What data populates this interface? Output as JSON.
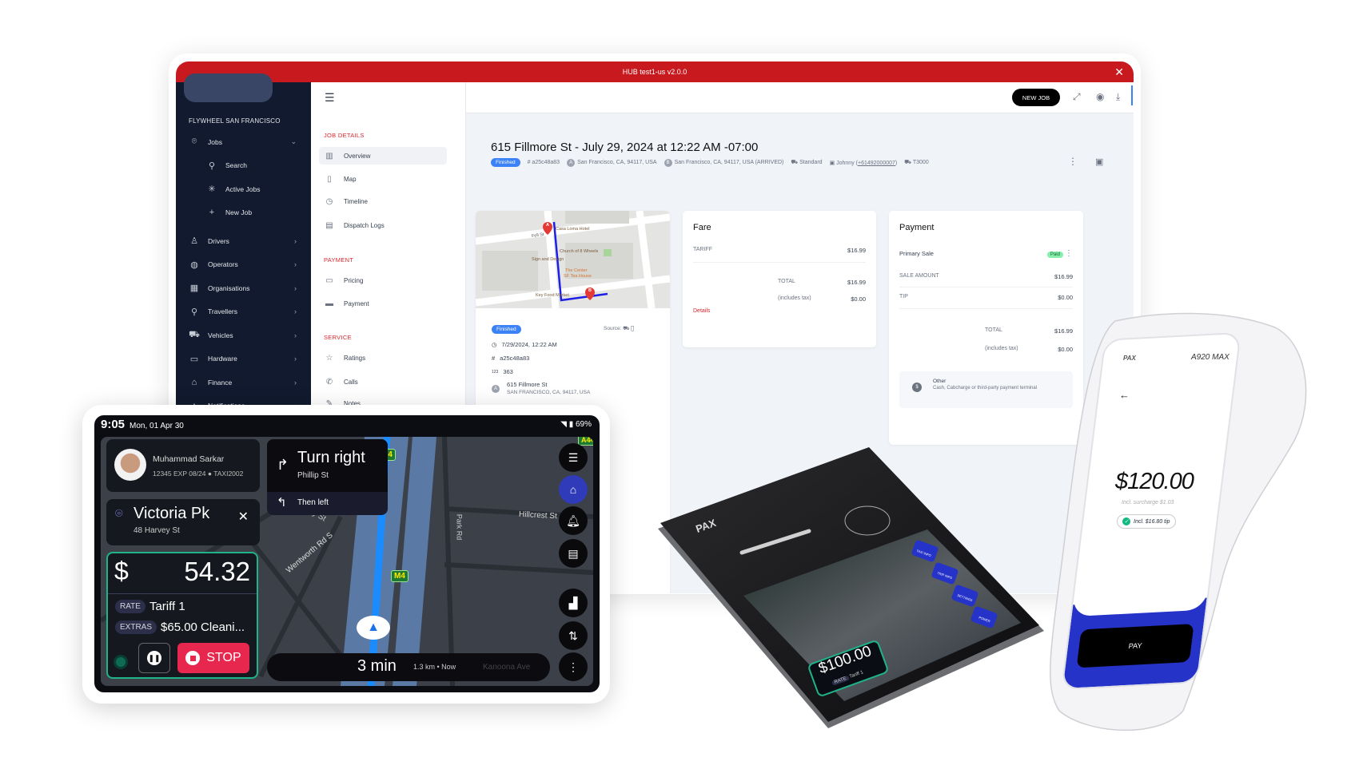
{
  "hub": {
    "window_title": "HUB test1-us v2.0.0",
    "org_name": "FLYWHEEL SAN FRANCISCO",
    "sidebar": [
      {
        "label": "Jobs",
        "icon": "map-pin-icon",
        "expanded": true
      },
      {
        "label": "Search",
        "icon": "search-icon",
        "sub": true
      },
      {
        "label": "Active Jobs",
        "icon": "loader-icon",
        "sub": true
      },
      {
        "label": "New Job",
        "icon": "plus-icon",
        "sub": true
      },
      {
        "label": "Drivers",
        "icon": "user-icon"
      },
      {
        "label": "Operators",
        "icon": "operators-icon"
      },
      {
        "label": "Organisations",
        "icon": "building-icon"
      },
      {
        "label": "Travellers",
        "icon": "traveller-icon"
      },
      {
        "label": "Vehicles",
        "icon": "car-icon"
      },
      {
        "label": "Hardware",
        "icon": "devices-icon"
      },
      {
        "label": "Finance",
        "icon": "bank-icon"
      },
      {
        "label": "Notifications",
        "icon": "bell-icon"
      }
    ],
    "secondary_nav": {
      "job_details": "JOB DETAILS",
      "overview": "Overview",
      "map": "Map",
      "timeline": "Timeline",
      "dispatch_logs": "Dispatch Logs",
      "payment_head": "PAYMENT",
      "pricing": "Pricing",
      "payment": "Payment",
      "service_head": "SERVICE",
      "ratings": "Ratings",
      "calls": "Calls",
      "notes": "Notes"
    },
    "header": {
      "new_job": "NEW JOB"
    },
    "job": {
      "title": "615 Fillmore St - July 29, 2024 at 12:22 AM -07:00",
      "status": "Finished",
      "id": "a25c48a83",
      "pickup": "San Francisco, CA, 94117, USA",
      "dropoff": "San Francisco, CA, 94117, USA (ARRIVED)",
      "service": "Standard",
      "driver": "Johnny (",
      "driver_phone": "+61492000007",
      "driver_close": ")",
      "vehicle": "T3000"
    },
    "map_labels": {
      "hotel": "Casa Loma Hotel",
      "street": "Fell St",
      "church": "Church of 8 Wheels",
      "sign": "Sign and Design",
      "center": "The Center",
      "tea": "SF Tea House",
      "market": "Key Food Market",
      "pin_a": "A",
      "pin_b": "B"
    },
    "details": {
      "status": "Finished",
      "source_label": "Source:",
      "datetime": "7/29/2024, 12:22 AM",
      "id": "a25c48a83",
      "number": "363",
      "address_line1": "615 Fillmore St",
      "address_line2": "SAN FRANCISCO, CA, 94117, USA"
    },
    "fare": {
      "title": "Fare",
      "tariff_label": "TARIFF",
      "tariff": "$16.99",
      "total_label": "TOTAL",
      "total": "$16.99",
      "tax_label": "(includes tax)",
      "tax": "$0.00",
      "details_link": "Details"
    },
    "payment": {
      "title": "Payment",
      "primary_sale": "Primary Sale",
      "status": "Paid",
      "sale_amount_label": "SALE AMOUNT",
      "sale_amount": "$16.99",
      "tip_label": "TIP",
      "tip": "$0.00",
      "total_label": "TOTAL",
      "total": "$16.99",
      "tax_label": "(includes tax)",
      "tax": "$0.00",
      "method_title": "Other",
      "method_desc": "Cash, Cabcharge or third-party payment terminal"
    }
  },
  "driver_tablet": {
    "time": "9:05",
    "date": "Mon, 01 Apr 30",
    "battery": "69%",
    "driver_name": "Muhammad Sarkar",
    "driver_info": "12345 EXP 08/24 ● TAXI2002",
    "nav_primary": "Turn right",
    "nav_street": "Phillip St",
    "nav_next": "Then left",
    "destination": "Victoria Pk",
    "destination_address": "48 Harvey St",
    "currency": "$",
    "fare": "54.32",
    "rate_label": "RATE",
    "rate": "Tariff 1",
    "extras_label": "EXTRAS",
    "extras": "$65.00 Cleani...",
    "stop": "STOP",
    "eta": "3 min",
    "eta_detail": "1.3 km • Now",
    "map_streets": [
      "Hillcrest St",
      "Park Rd",
      "Wentworth Rd S",
      "Pomeroy St",
      "Kanoona Ave"
    ],
    "road_shield": "M4",
    "road_shield_2": "A44"
  },
  "pax_terminal": {
    "brand": "PAX",
    "amount": "$100.00",
    "rate_label": "RATE",
    "rate": "Tariff 1",
    "buttons": [
      "TAXI INFO",
      "TRIP INFO",
      "SETTINGS",
      "POWER"
    ]
  },
  "pax_handheld": {
    "brand": "PAX",
    "model": "A920 MAX",
    "amount": "$120.00",
    "surcharge": "Incl. surcharge $1.03",
    "tip": "Incl. $16.80 tip",
    "pay": "PAY"
  },
  "colors": {
    "brand_red": "#c8191e",
    "sidebar": "#111a2e",
    "accent_blue": "#3b82f6",
    "stop": "#e8274f",
    "handheld_blue": "#2633c8",
    "fare_border": "#1fb38a"
  }
}
